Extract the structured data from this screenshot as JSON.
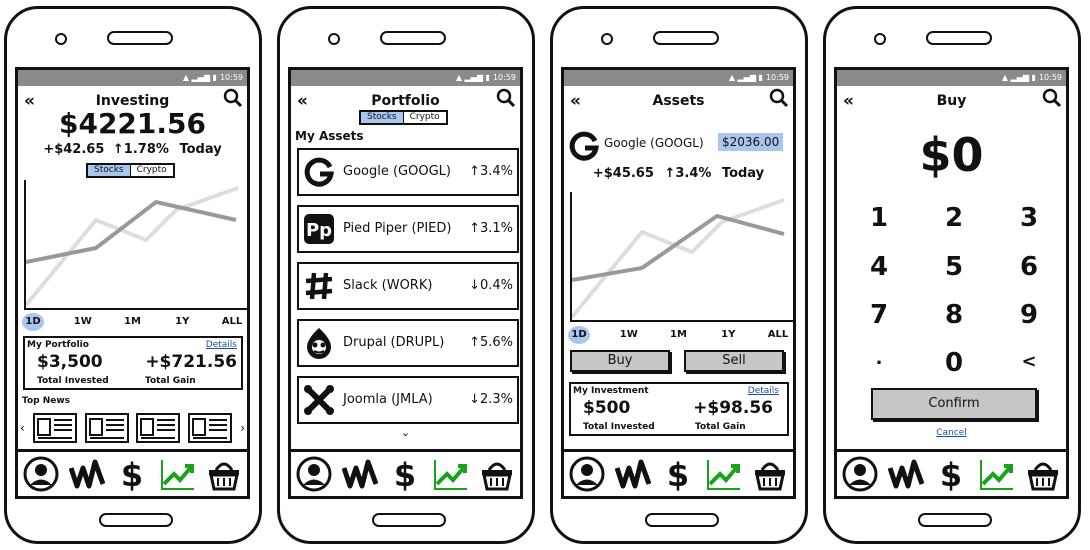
{
  "status": {
    "time": "10:59"
  },
  "investing": {
    "title": "Investing",
    "balance": "$4221.56",
    "change_amount": "+$42.65",
    "change_pct": "↑1.78%",
    "change_period": "Today",
    "tabs": [
      "Stocks",
      "Crypto"
    ],
    "ranges": [
      "1D",
      "1W",
      "1M",
      "1Y",
      "ALL"
    ],
    "portfolio": {
      "heading": "My Portfolio",
      "details": "Details",
      "invested_value": "$3,500",
      "invested_label": "Total Invested",
      "gain_value": "+$721.56",
      "gain_label": "Total Gain"
    },
    "news_heading": "Top News",
    "prev": "‹",
    "next": "›"
  },
  "portfolio": {
    "title": "Portfolio",
    "tabs": [
      "Stocks",
      "Crypto"
    ],
    "assets_heading": "My Assets",
    "assets": [
      {
        "name": "Google (GOOGL)",
        "change": "↑3.4%",
        "icon": "google-icon"
      },
      {
        "name": "Pied Piper (PIED)",
        "change": "↑3.1%",
        "icon": "pied-piper-icon"
      },
      {
        "name": "Slack (WORK)",
        "change": "↓0.4%",
        "icon": "slack-icon"
      },
      {
        "name": "Drupal (DRUPL)",
        "change": "↑5.6%",
        "icon": "drupal-icon"
      },
      {
        "name": "Joomla (JMLA)",
        "change": "↓2.3%",
        "icon": "joomla-icon"
      }
    ],
    "more": "⌄"
  },
  "assets": {
    "title": "Assets",
    "stock_name": "Google (GOOGL)",
    "price": "$2036.00",
    "change_amount": "+$45.65",
    "change_pct": "↑3.4%",
    "change_period": "Today",
    "ranges": [
      "1D",
      "1W",
      "1M",
      "1Y",
      "ALL"
    ],
    "buy_label": "Buy",
    "sell_label": "Sell",
    "investment": {
      "heading": "My Investment",
      "details": "Details",
      "invested_value": "$500",
      "invested_label": "Total Invested",
      "gain_value": "+$98.56",
      "gain_label": "Total Gain"
    }
  },
  "buy": {
    "title": "Buy",
    "amount": "$0",
    "keys": [
      "1",
      "2",
      "3",
      "4",
      "5",
      "6",
      "7",
      "8",
      "9",
      ".",
      "0",
      "<"
    ],
    "confirm_label": "Confirm",
    "cancel_label": "Cancel"
  },
  "colors": {
    "accent": "#a9c7ee",
    "highlight": "#a9c7ee",
    "trend_green": "#1aa31a",
    "chart_dark": "#999999",
    "chart_light": "#dddddd"
  },
  "nav_icons": [
    "account-icon",
    "wealthsimple-icon",
    "dollar-icon",
    "trending-icon",
    "basket-icon"
  ]
}
